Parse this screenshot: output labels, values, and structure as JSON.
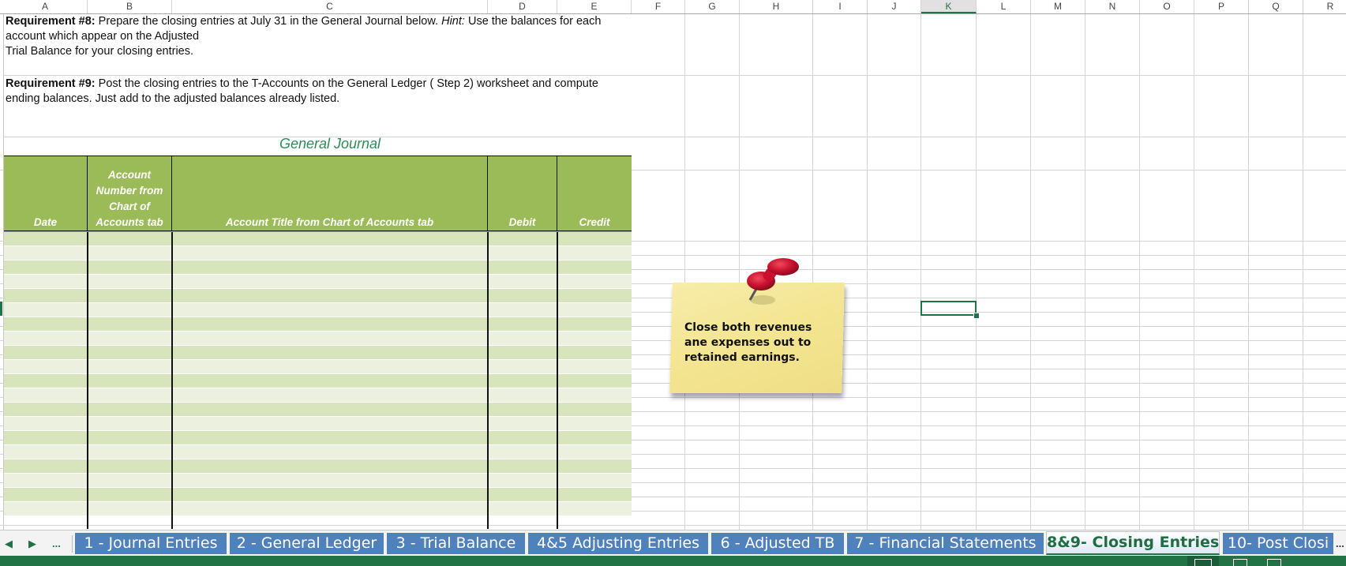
{
  "columns": [
    "A",
    "B",
    "C",
    "D",
    "E",
    "F",
    "G",
    "H",
    "I",
    "J",
    "K",
    "L",
    "M",
    "N",
    "O",
    "P",
    "Q",
    "R"
  ],
  "selected_column": "K",
  "requirements": {
    "req8": {
      "label": "Requirement #8:",
      "text_before_hint": " Prepare the closing entries at July 31 in the General Journal below. ",
      "hint_label": "Hint:",
      "text_after_hint_line1": " Use the balances for each account which appear on the Adjusted",
      "line2": "Trial Balance for your closing entries."
    },
    "req9": {
      "label": "Requirement #9:",
      "text": " Post the closing entries to the T-Accounts on the General Ledger  ( Step 2) worksheet and compute ending balances. Just add to the adjusted balances already listed."
    }
  },
  "journal": {
    "title": "General Journal",
    "headers": {
      "date": "Date",
      "account_number": "Account Number from Chart of Accounts tab",
      "account_title": "Account Title from Chart of Accounts tab",
      "debit": "Debit",
      "credit": "Credit"
    },
    "row_count": 20,
    "colors": {
      "header": "#9bbb59",
      "row_odd": "#d8e4bc",
      "row_even": "#ebf1de",
      "title": "#2e8b57"
    }
  },
  "sticky_note": {
    "text": "Close both revenues ane expenses out to retained earnings.",
    "icon": "pushpin-icon"
  },
  "sheet_tabs": {
    "nav": {
      "prev": "◀",
      "next": "▶",
      "more": "..."
    },
    "tabs": [
      {
        "label": "1 - Journal Entries",
        "active": false
      },
      {
        "label": "2 - General Ledger",
        "active": false
      },
      {
        "label": "3 - Trial Balance",
        "active": false
      },
      {
        "label": "4&5 Adjusting Entries",
        "active": false
      },
      {
        "label": "6 - Adjusted TB",
        "active": false
      },
      {
        "label": "7 - Financial Statements",
        "active": false
      },
      {
        "label": "8&9- Closing Entries",
        "active": true
      },
      {
        "label": "10- Post Closi",
        "active": false
      }
    ],
    "overflow": "..."
  },
  "colors": {
    "excel_green": "#217346",
    "tab_blue": "#4f81bd"
  }
}
